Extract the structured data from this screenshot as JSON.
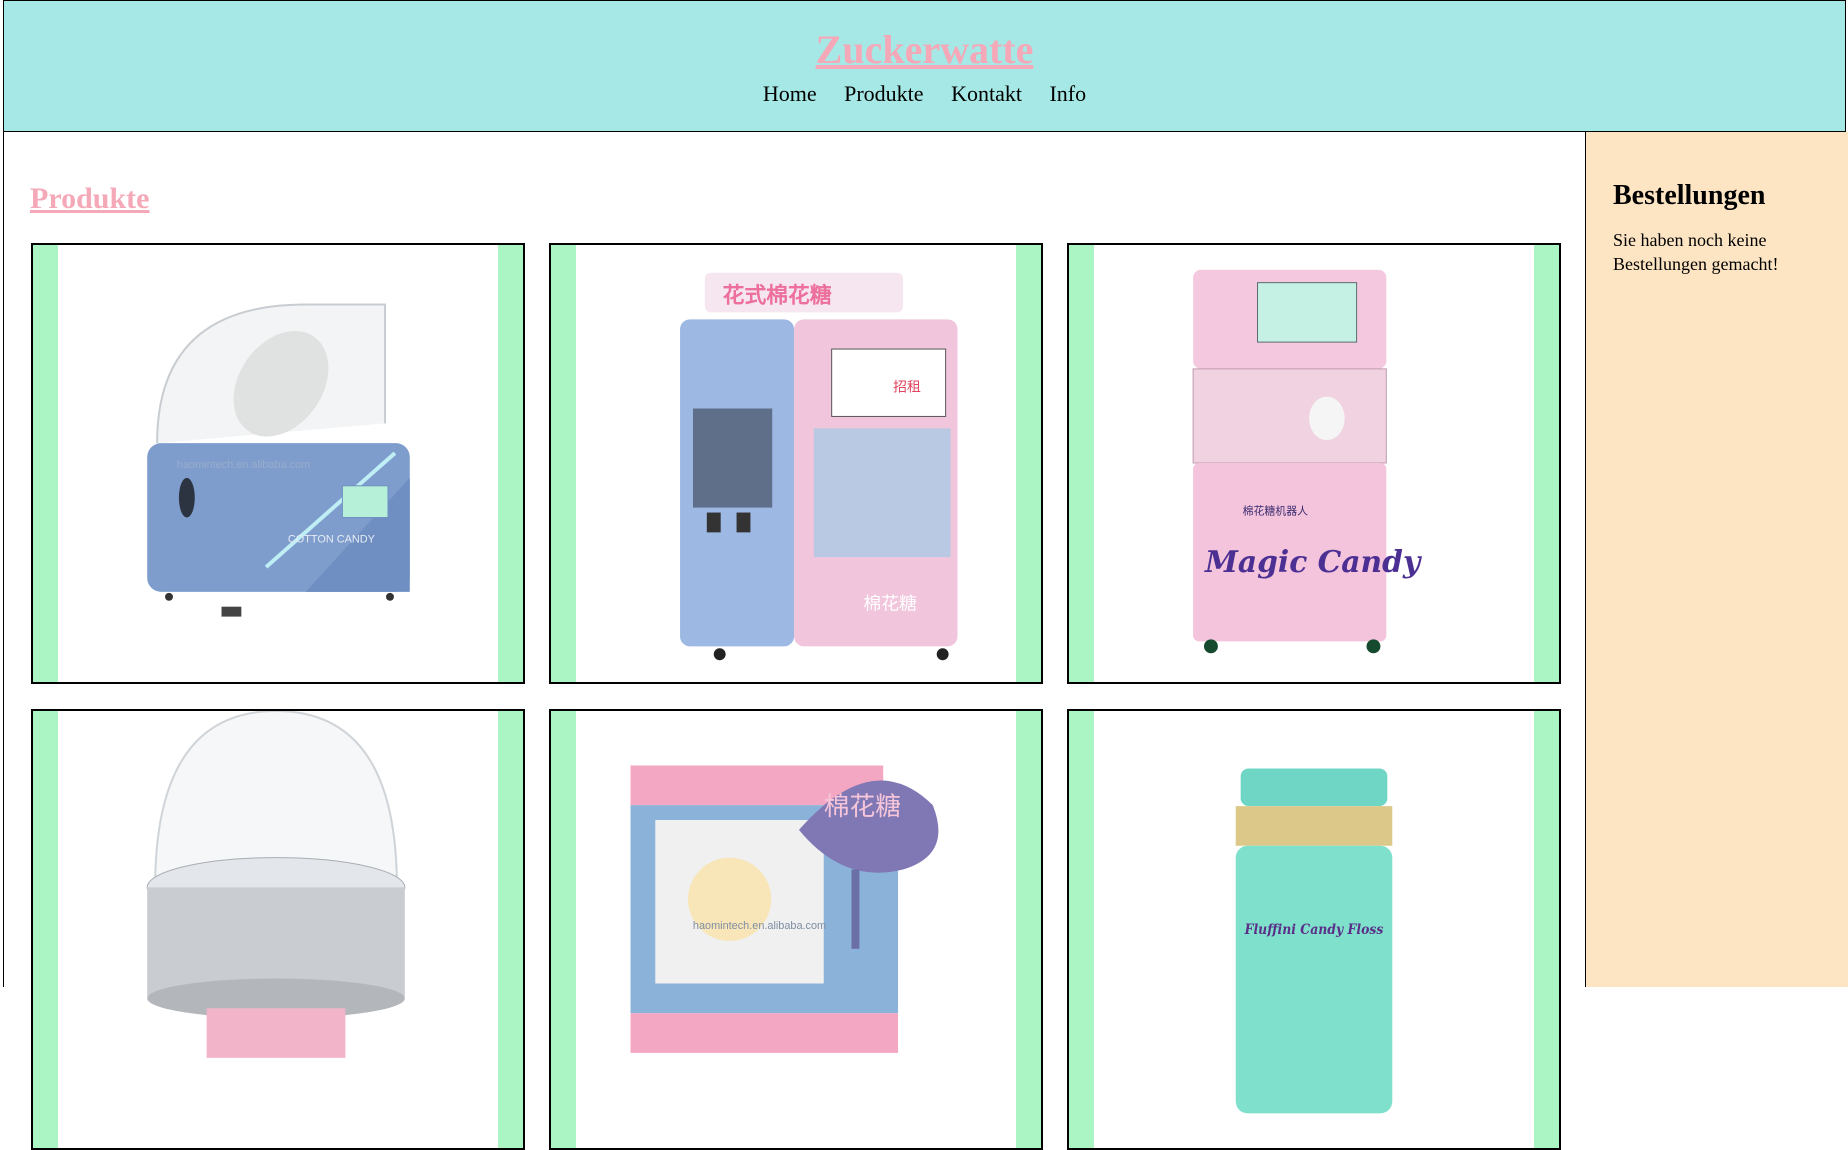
{
  "header": {
    "title": "Zuckerwatte",
    "nav": [
      "Home",
      "Produkte",
      "Kontakt",
      "Info"
    ]
  },
  "main": {
    "section_title": "Produkte",
    "products": [
      {
        "image": "compact blue cotton candy machine with clear dome",
        "watermark": "haomintech.en.alibaba.com",
        "brand_text": "COTTON CANDY"
      },
      {
        "image": "blue and pink cotton candy vending machine",
        "sign": "花式棉花糖",
        "screen_text": "招租",
        "logo": "棉花糖"
      },
      {
        "image": "pink Magic Candy robot vending machine",
        "sign": "棉花糖机器人",
        "logo": "Magic Candy"
      },
      {
        "image": "stainless steel cotton candy maker with clear dome"
      },
      {
        "image": "blue kiosk with pink umbrella",
        "umbrella_text": "棉花糖",
        "watermark": "haomintech.en.alibaba.com"
      },
      {
        "image": "jar of Fluffini Candy Floss",
        "label": "Fluffini Candy Floss"
      }
    ]
  },
  "sidebar": {
    "title": "Bestellungen",
    "empty_message": "Sie haben noch keine Bestellungen gemacht!"
  },
  "colors": {
    "header_bg": "#a5e8e5",
    "title_pink": "#f5a9b8",
    "card_border_green": "#abf5c5",
    "sidebar_bg": "#fde5c4"
  }
}
